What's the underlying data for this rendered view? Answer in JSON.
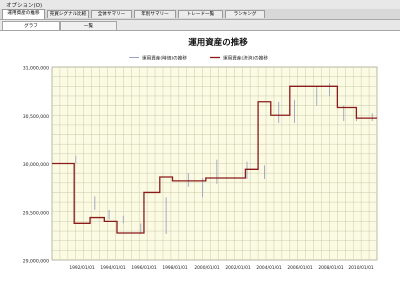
{
  "menu": {
    "label": "オプション(O)"
  },
  "main_tabs": [
    {
      "label": "運用資産の推移",
      "active": true
    },
    {
      "label": "売買シグナル比較",
      "active": false
    },
    {
      "label": "全体サマリー",
      "active": false
    },
    {
      "label": "年別サマリー",
      "active": false
    },
    {
      "label": "トレード一覧",
      "active": false
    },
    {
      "label": "ランキング",
      "active": false
    }
  ],
  "sub_tabs": [
    {
      "label": "グラフ",
      "active": true
    },
    {
      "label": "一覧",
      "active": false
    }
  ],
  "colors": {
    "plot_bg": "#fbfbe4",
    "grid": "#c8c4a4",
    "line_realized": "#9aa3bf",
    "line_close": "#8b1a1a"
  },
  "chart_data": {
    "type": "line",
    "title": "運用資産の推移",
    "xlabel": "",
    "ylabel": "",
    "x_tick_labels": [
      "1992/01/01",
      "1994/01/01",
      "1996/01/01",
      "1998/01/01",
      "2000/01/01",
      "2002/01/01",
      "2004/01/01",
      "2006/01/01",
      "2008/01/01",
      "2010/01/01"
    ],
    "y_tick_labels": [
      "31,000,000",
      "30,500,000",
      "30,000,000",
      "29,500,000",
      "29,000,000"
    ],
    "xlim": [
      1990.0,
      2010.5
    ],
    "ylim": [
      29000000,
      31000000
    ],
    "grid": true,
    "legend_position": "top",
    "series": [
      {
        "name": "運用資産(時価)の推移",
        "style": "spikes",
        "values": [
          [
            1991.5,
            30000000,
            30080000
          ],
          [
            1992.7,
            29520000,
            29660000
          ],
          [
            1993.6,
            29420000,
            29520000
          ],
          [
            1994.5,
            29380000,
            29460000
          ],
          [
            1995.6,
            29270000,
            29380000
          ],
          [
            1997.2,
            29270000,
            29650000
          ],
          [
            1998.6,
            29760000,
            29900000
          ],
          [
            1999.5,
            29650000,
            29850000
          ],
          [
            2000.4,
            29790000,
            30040000
          ],
          [
            2002.3,
            29840000,
            30020000
          ],
          [
            2003.4,
            29840000,
            29980000
          ],
          [
            2004.3,
            30420000,
            30640000
          ],
          [
            2005.3,
            30420000,
            30660000
          ],
          [
            2006.7,
            30600000,
            30800000
          ],
          [
            2007.5,
            30700000,
            30830000
          ],
          [
            2008.4,
            30440000,
            30600000
          ],
          [
            2009.2,
            30440000,
            30560000
          ],
          [
            2010.2,
            30440000,
            30520000
          ]
        ]
      },
      {
        "name": "運用資産(決済)の推移",
        "style": "step",
        "values": [
          [
            1990.0,
            30000000
          ],
          [
            1991.4,
            30000000
          ],
          [
            1991.4,
            29380000
          ],
          [
            1992.4,
            29380000
          ],
          [
            1992.4,
            29440000
          ],
          [
            1993.3,
            29440000
          ],
          [
            1993.3,
            29400000
          ],
          [
            1994.1,
            29400000
          ],
          [
            1994.1,
            29280000
          ],
          [
            1995.8,
            29280000
          ],
          [
            1995.8,
            29700000
          ],
          [
            1996.8,
            29700000
          ],
          [
            1996.8,
            29860000
          ],
          [
            1997.6,
            29860000
          ],
          [
            1997.6,
            29820000
          ],
          [
            1999.7,
            29820000
          ],
          [
            1999.7,
            29850000
          ],
          [
            2002.2,
            29850000
          ],
          [
            2002.2,
            29940000
          ],
          [
            2003.0,
            29940000
          ],
          [
            2003.0,
            30640000
          ],
          [
            2003.8,
            30640000
          ],
          [
            2003.8,
            30500000
          ],
          [
            2005.0,
            30500000
          ],
          [
            2005.0,
            30800000
          ],
          [
            2008.0,
            30800000
          ],
          [
            2008.0,
            30580000
          ],
          [
            2009.2,
            30580000
          ],
          [
            2009.2,
            30470000
          ],
          [
            2010.5,
            30470000
          ]
        ]
      }
    ]
  }
}
